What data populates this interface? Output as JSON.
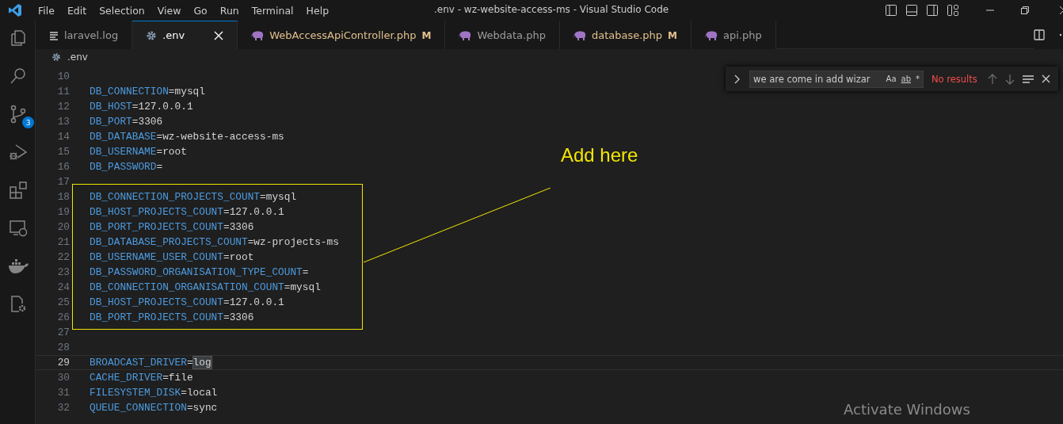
{
  "window": {
    "title": ".env - wz-website-access-ms - Visual Studio Code"
  },
  "menu": [
    "File",
    "Edit",
    "Selection",
    "View",
    "Go",
    "Run",
    "Terminal",
    "Help"
  ],
  "activity_bar": [
    {
      "kind": "files",
      "selected": false
    },
    {
      "kind": "search",
      "selected": false
    },
    {
      "kind": "source-control",
      "selected": false,
      "badge": "3"
    },
    {
      "kind": "debug",
      "selected": false
    },
    {
      "kind": "extensions",
      "selected": false
    },
    {
      "kind": "remote",
      "selected": false
    },
    {
      "kind": "docker",
      "selected": false
    },
    {
      "kind": "settings-file",
      "selected": false
    }
  ],
  "tabs": [
    {
      "label": "laravel.log",
      "kind": "log",
      "selected": false
    },
    {
      "label": ".env",
      "kind": "config",
      "selected": true
    },
    {
      "label": "WebAccessApiController.php",
      "kind": "php",
      "selected": false,
      "modified": "M"
    },
    {
      "label": "Webdata.php",
      "kind": "php",
      "selected": false
    },
    {
      "label": "database.php",
      "kind": "php",
      "selected": false,
      "modified": "M"
    },
    {
      "label": "api.php",
      "kind": "php",
      "selected": false
    }
  ],
  "breadcrumb": ".env",
  "editor": {
    "lines": [
      {
        "number": "10",
        "current": false
      },
      {
        "number": "11",
        "key": "DB_CONNECTION",
        "sep": "=",
        "value": "mysql",
        "current": false
      },
      {
        "number": "12",
        "key": "DB_HOST",
        "sep": "=",
        "value": "127.0.0.1",
        "current": false
      },
      {
        "number": "13",
        "key": "DB_PORT",
        "sep": "=",
        "value": "3306",
        "current": false
      },
      {
        "number": "14",
        "key": "DB_DATABASE",
        "sep": "=",
        "value": "wz-website-access-ms",
        "current": false
      },
      {
        "number": "15",
        "key": "DB_USERNAME",
        "sep": "=",
        "value": "root",
        "current": false
      },
      {
        "number": "16",
        "key": "DB_PASSWORD",
        "sep": "=",
        "current": false
      },
      {
        "number": "17",
        "current": false
      },
      {
        "number": "18",
        "key": "DB_CONNECTION_PROJECTS_COUNT",
        "sep": "=",
        "value": "mysql",
        "current": false
      },
      {
        "number": "19",
        "key": "DB_HOST_PROJECTS_COUNT",
        "sep": "=",
        "value": "127.0.0.1",
        "current": false
      },
      {
        "number": "20",
        "key": "DB_PORT_PROJECTS_COUNT",
        "sep": "=",
        "value": "3306",
        "current": false
      },
      {
        "number": "21",
        "key": "DB_DATABASE_PROJECTS_COUNT",
        "sep": "=",
        "value": "wz-projects-ms",
        "current": false
      },
      {
        "number": "22",
        "key": "DB_USERNAME_USER_COUNT",
        "sep": "=",
        "value": "root",
        "current": false
      },
      {
        "number": "23",
        "key": "DB_PASSWORD_ORGANISATION_TYPE_COUNT",
        "sep": "=",
        "current": false
      },
      {
        "number": "24",
        "key": "DB_CONNECTION_ORGANISATION_COUNT",
        "sep": "=",
        "value": "mysql",
        "current": false
      },
      {
        "number": "25",
        "key": "DB_HOST_PROJECTS_COUNT",
        "sep": "=",
        "value": "127.0.0.1",
        "current": false
      },
      {
        "number": "26",
        "key": "DB_PORT_PROJECTS_COUNT",
        "sep": "=",
        "value": "3306",
        "current": false
      },
      {
        "number": "27",
        "current": false
      },
      {
        "number": "28",
        "current": false
      },
      {
        "number": "29",
        "key": "BROADCAST_DRIVER",
        "sep": "=",
        "value": "log",
        "current": true
      },
      {
        "number": "30",
        "key": "CACHE_DRIVER",
        "sep": "=",
        "value": "file",
        "current": false
      },
      {
        "number": "31",
        "key": "FILESYSTEM_DISK",
        "sep": "=",
        "value": "local",
        "current": false
      },
      {
        "number": "32",
        "key": "QUEUE_CONNECTION",
        "sep": "=",
        "value": "sync",
        "current": false
      }
    ]
  },
  "find_widget": {
    "value": "we are come in add wizar",
    "options": [
      "Aa",
      "ab",
      "*"
    ],
    "status": "No results"
  },
  "annotation": {
    "label": "Add here"
  },
  "overlay_notice": "Activate Windows"
}
